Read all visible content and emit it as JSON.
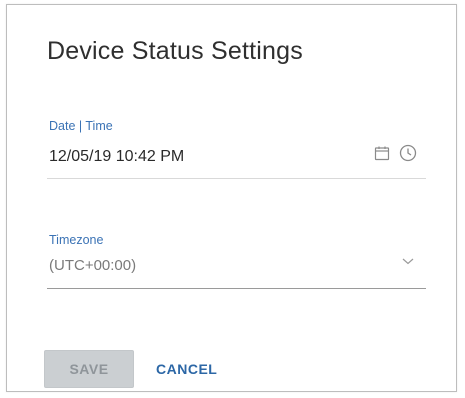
{
  "dialog": {
    "title": "Device Status Settings"
  },
  "date_time_field": {
    "label": "Date | Time",
    "value": "12/05/19 10:42 PM",
    "icons": [
      "calendar-icon",
      "clock-icon"
    ]
  },
  "timezone_field": {
    "label": "Timezone",
    "value": "(UTC+00:00)",
    "icon": "chevron-down-icon"
  },
  "actions": {
    "save_label": "SAVE",
    "cancel_label": "CANCEL"
  },
  "colors": {
    "label_blue": "#3b73b5",
    "cancel_blue": "#2c67a6",
    "disabled_button_bg": "#cbcfd2",
    "disabled_button_text": "#8f959a"
  }
}
